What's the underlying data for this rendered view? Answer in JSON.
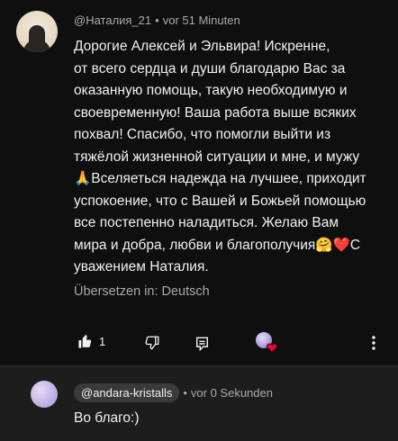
{
  "comment": {
    "author": "@Наталия_21",
    "separator": "•",
    "time": "vor 51 Minuten",
    "text": "Дорогие Алексей и Эльвира! Искренне,\nот всего сердца и души благодарю Вас за\nоказанную помощь, такую необходимую и\nсвоевременную! Ваша работа выше всяких\nпохвал! Спасибо, что помогли выйти из\nтяжёлой жизненной ситуации и мне, и мужу\n🙏Вселяеться надежда на лучшее, приходит\nуспокоение, что с Вашей и Божьей помощью\nвсе постепенно наладиться. Желаю Вам\nмира и добра, любви и благополучия🤗❤️С\nуважением Наталия.",
    "translate_label": "Übersetzen in: Deutsch",
    "like_count": "1",
    "icons": {
      "like": "thumbs-up-filled-icon",
      "dislike": "thumbs-down-icon",
      "reply": "reply-icon",
      "creator_heart": "creator-heart-badge",
      "more": "more-vertical-icon"
    },
    "colors": {
      "heart": "#ff0033",
      "secondary_text": "#aaaaaa"
    }
  },
  "reply": {
    "author": "@andara-kristalls",
    "separator": "•",
    "time": "vor 0 Sekunden",
    "text": "Во благо:)"
  }
}
